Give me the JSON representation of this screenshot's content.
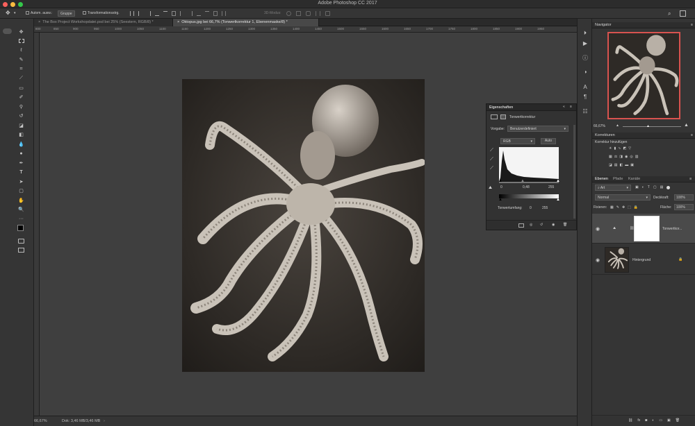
{
  "app": {
    "title": "Adobe Photoshop CC 2017"
  },
  "options": {
    "auto_select_label": "Autom. ausw.:",
    "auto_select_value": "Gruppe",
    "transform_label": "Transformationsstrg.",
    "mode_3d_label": "3D-Modus:"
  },
  "tabs": [
    {
      "label": "The Box Project Workshopdatei.psd bei 25% (Seestern, RGB/8) *"
    },
    {
      "label": "Oktopus.jpg bei 66,7% (Tonwertkorrektur 1, Ebenenmaske/8) *"
    }
  ],
  "ruler": {
    "ticks": [
      "800",
      "850",
      "900",
      "950",
      "1000",
      "1050",
      "1100",
      "1150",
      "1200",
      "1250",
      "1300",
      "1350",
      "1400",
      "1450",
      "1500",
      "1550",
      "1600",
      "1650",
      "1700",
      "1750",
      "1800",
      "1850",
      "1900",
      "1950"
    ]
  },
  "status": {
    "zoom": "66,67%",
    "doc": "Dok: 3,46 MB/3,46 MB"
  },
  "properties": {
    "title": "Eigenschaften",
    "adjustment": "Tonwertkorrektur",
    "preset_label": "Vorgabe:",
    "preset_value": "Benutzerdefiniert",
    "channel": "RGB",
    "auto": "Auto",
    "input_black": "0",
    "input_mid": "0,48",
    "input_white": "255",
    "output_label": "Tonwertumfang:",
    "output_black": "0",
    "output_white": "255"
  },
  "navigator": {
    "title": "Navigator",
    "zoom": "66,67%"
  },
  "adjustments": {
    "tab": "Korrekturen",
    "subtitle": "Korrektur hinzufügen"
  },
  "layers": {
    "tabs": [
      "Ebenen",
      "Pfade",
      "Kanäle"
    ],
    "filter_kind": "Art",
    "blend_mode": "Normal",
    "opacity_label": "Deckkraft:",
    "opacity_value": "100%",
    "lock_label": "Fixieren:",
    "fill_label": "Fläche:",
    "fill_value": "100%",
    "items": [
      {
        "name": "Tonwertkor..."
      },
      {
        "name": "Hintergrund"
      }
    ]
  },
  "colors": {
    "accent_red": "#d9534f",
    "panel": "#353535",
    "canvas": "#3f3f3f"
  }
}
